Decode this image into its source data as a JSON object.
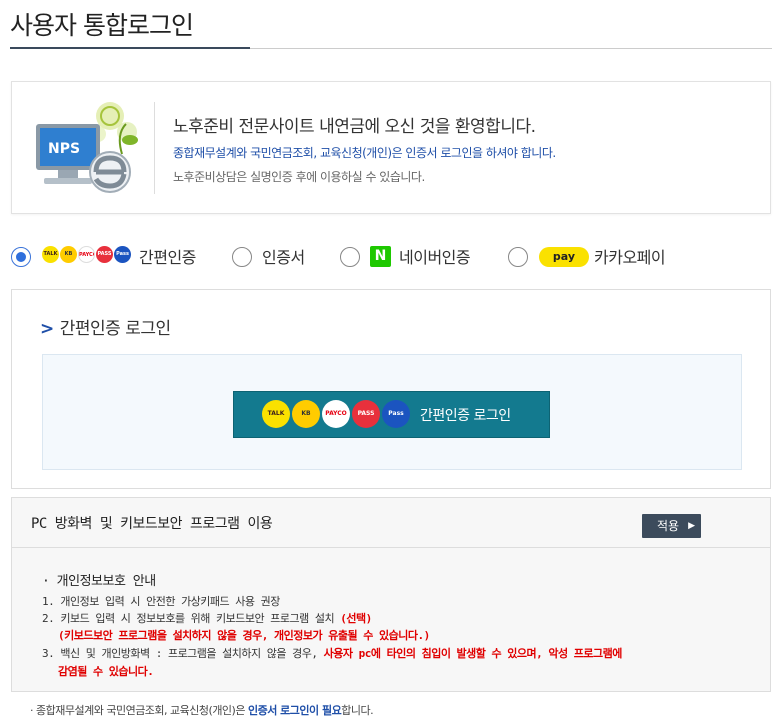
{
  "page": {
    "title": "사용자 통합로그인"
  },
  "welcome": {
    "logo_text": "NPS",
    "title": "노후준비 전문사이트 내연금에 오신 것을 환영합니다.",
    "notice_blue": "종합재무설계와 국민연금조회, 교육신청(개인)은 인증서 로그인을 하셔야 합니다.",
    "notice_gray": "노후준비상담은 실명인증 후에 이용하실 수 있습니다."
  },
  "login_methods": {
    "selected": "simple",
    "options": [
      {
        "id": "simple",
        "label": "간편인증"
      },
      {
        "id": "cert",
        "label": "인증서"
      },
      {
        "id": "naver",
        "label": "네이버인증"
      },
      {
        "id": "kakaopay",
        "label": "카카오페이"
      }
    ],
    "naver_logo": "N",
    "kakaopay_logo": "pay",
    "simple_logos": [
      "TALK",
      "KB",
      "PAYCO",
      "PASS",
      "Pass"
    ]
  },
  "simple_login": {
    "heading": "간편인증 로그인",
    "button_label": "간편인증 로그인",
    "logos": [
      "TALK",
      "KB",
      "PAYCO",
      "PASS",
      "Pass"
    ]
  },
  "security": {
    "title": "PC 방화벽 및 키보드보안 프로그램 이용",
    "apply_label": "적용",
    "privacy_title": "· 개인정보보호 안내",
    "items": [
      {
        "num": "1.",
        "text": "개인정보 입력 시 안전한 가상키패드 사용 권장"
      },
      {
        "num": "2.",
        "text": "키보드 입력 시 정보보호를 위해 키보드보안 프로그램 설치 ",
        "red": "(선택)",
        "red_line": "(키보드보안 프로그램을 설치하지 않을 경우, 개인정보가 유출될 수 있습니다.)"
      },
      {
        "num": "3.",
        "text": "백신 및 개인방화벽 : 프로그램을 설치하지 않을 경우, ",
        "red": "사용자 pc에 타인의 침입이 발생할 수 있으며, 악성 프로그램에",
        "red_line": "감염될 수 있습니다."
      }
    ]
  },
  "footnote": {
    "prefix": "· 종합재무설계와 국민연금조회, 교육신청(개인)은 ",
    "blue": "인증서 로그인이 필요",
    "suffix": "합니다."
  }
}
